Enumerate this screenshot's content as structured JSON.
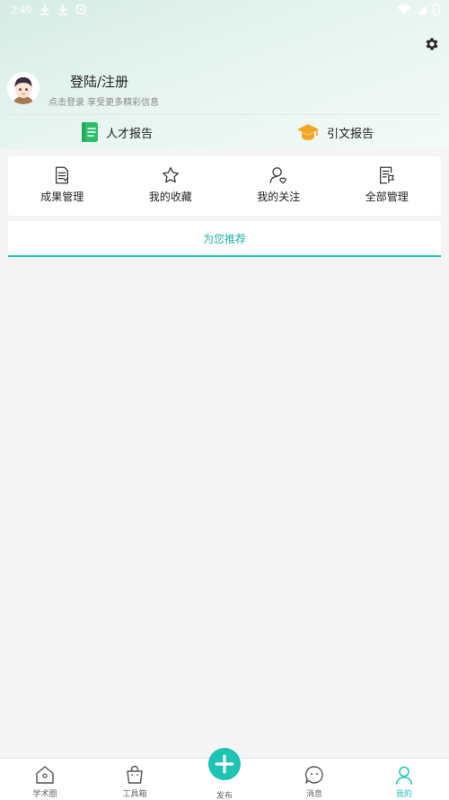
{
  "status_bar": {
    "time": "2:49"
  },
  "profile": {
    "login_title": "登陆/注册",
    "login_subtitle": "点击登录 享受更多精彩信息"
  },
  "reports": [
    {
      "label": "人才报告",
      "icon": "green-book-icon",
      "color": "#2ebf6a"
    },
    {
      "label": "引文报告",
      "icon": "graduation-cap-icon",
      "color": "#f5a623"
    }
  ],
  "quick_actions": [
    {
      "label": "成果管理",
      "icon": "document-icon"
    },
    {
      "label": "我的收藏",
      "icon": "star-icon"
    },
    {
      "label": "我的关注",
      "icon": "user-heart-icon"
    },
    {
      "label": "全部管理",
      "icon": "document-flag-icon"
    }
  ],
  "recommend": {
    "label": "为您推荐"
  },
  "bottom_nav": [
    {
      "label": "学术圈",
      "icon": "home-icon"
    },
    {
      "label": "工具箱",
      "icon": "bag-icon"
    },
    {
      "label": "发布",
      "icon": "plus-icon"
    },
    {
      "label": "消息",
      "icon": "message-face-icon"
    },
    {
      "label": "我的",
      "icon": "user-icon"
    }
  ],
  "colors": {
    "accent": "#1fc3b4"
  }
}
